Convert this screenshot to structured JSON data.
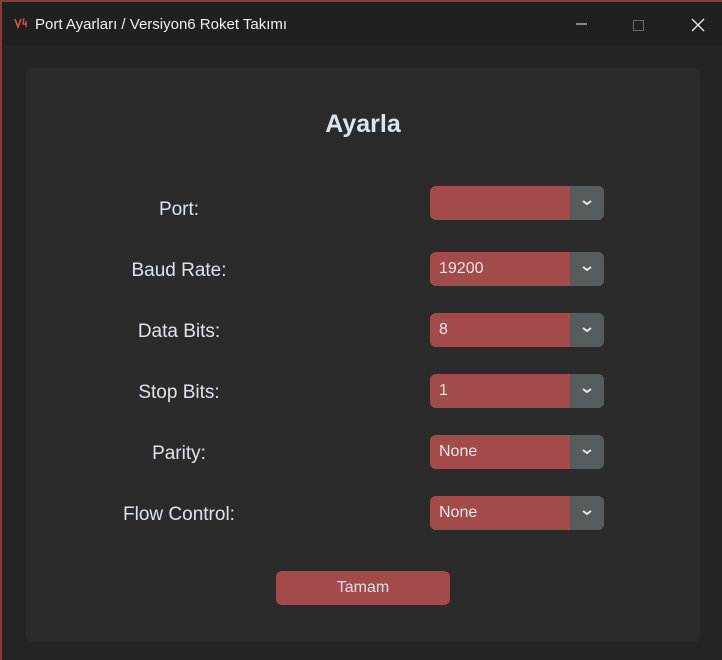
{
  "window": {
    "title": "Port Ayarları / Versiyon6 Roket Takımı",
    "icon": "app-logo-icon",
    "accent_color": "#a34a4a"
  },
  "form": {
    "heading": "Ayarla",
    "rows": [
      {
        "label": "Port:",
        "value": ""
      },
      {
        "label": "Baud Rate:",
        "value": "19200"
      },
      {
        "label": "Data Bits:",
        "value": "8"
      },
      {
        "label": "Stop Bits:",
        "value": "1"
      },
      {
        "label": "Parity:",
        "value": "None"
      },
      {
        "label": "Flow Control:",
        "value": "None"
      }
    ],
    "submit_label": "Tamam"
  }
}
